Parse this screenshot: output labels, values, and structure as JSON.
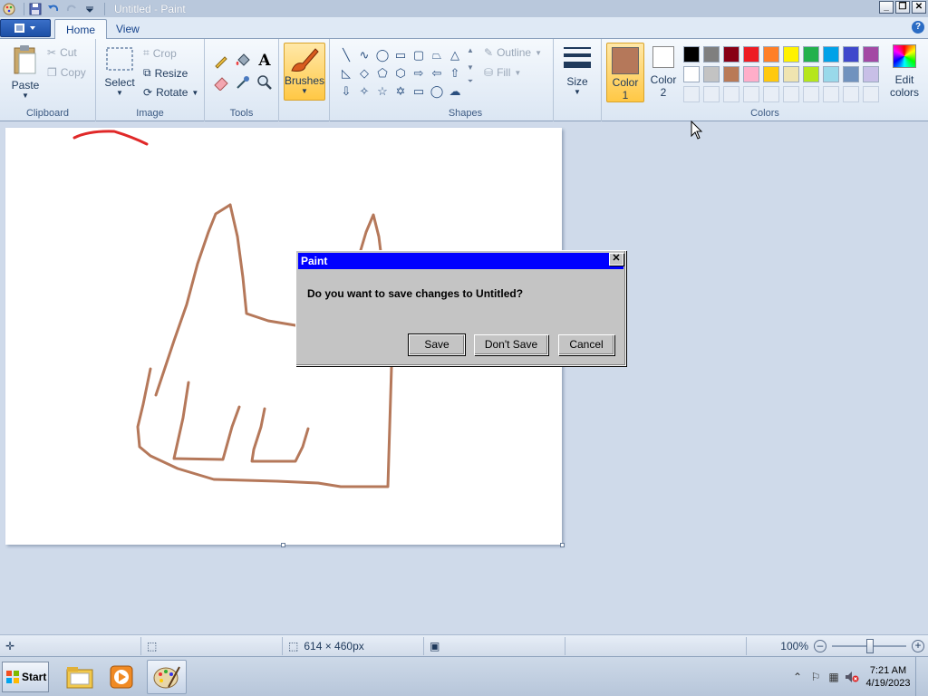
{
  "window": {
    "title": "Untitled - Paint"
  },
  "tabs": [
    {
      "label": "Home",
      "active": true
    },
    {
      "label": "View",
      "active": false
    }
  ],
  "ribbon": {
    "clipboard": {
      "label": "Clipboard",
      "paste": "Paste",
      "cut": "Cut",
      "copy": "Copy"
    },
    "image": {
      "label": "Image",
      "select": "Select",
      "crop": "Crop",
      "resize": "Resize",
      "rotate": "Rotate"
    },
    "tools": {
      "label": "Tools"
    },
    "brushes": "Brushes",
    "shapes": {
      "label": "Shapes",
      "outline": "Outline",
      "fill": "Fill"
    },
    "size": "Size",
    "colors": {
      "label": "Colors",
      "color1": "Color",
      "color1_num": "1",
      "color2": "Color",
      "color2_num": "2",
      "edit": "Edit",
      "edit2": "colors",
      "color1_value": "#b5785a",
      "color2_value": "#ffffff",
      "palette_row1": [
        "#000000",
        "#7f7f7f",
        "#880015",
        "#ed1c24",
        "#ff7f27",
        "#fff200",
        "#22b14c",
        "#00a2e8",
        "#3f48cc",
        "#a349a4"
      ],
      "palette_row2": [
        "#ffffff",
        "#c3c3c3",
        "#b97a57",
        "#ffaec9",
        "#ffc90e",
        "#efe4b0",
        "#b5e61d",
        "#99d9ea",
        "#7092be",
        "#c8bfe7"
      ]
    }
  },
  "dialog": {
    "title": "Paint",
    "message": "Do you want to save changes to Untitled?",
    "save": "Save",
    "dont_save": "Don't Save",
    "cancel": "Cancel"
  },
  "statusbar": {
    "dimensions": "614 × 460px",
    "zoom": "100%"
  },
  "taskbar": {
    "start": "Start",
    "time": "7:21 AM",
    "date": "4/19/2023"
  }
}
